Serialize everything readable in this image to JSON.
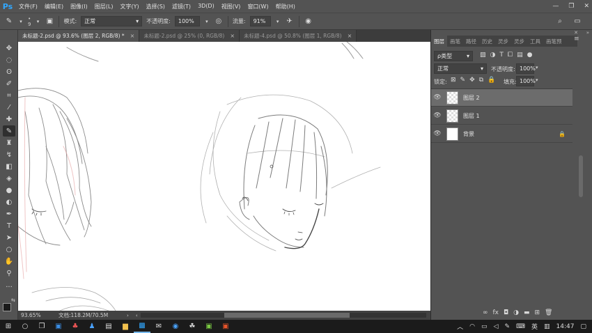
{
  "app": {
    "logo": "Ps"
  },
  "menu": [
    "文件(F)",
    "编辑(E)",
    "图像(I)",
    "图层(L)",
    "文字(Y)",
    "选择(S)",
    "滤镜(T)",
    "3D(D)",
    "视图(V)",
    "窗口(W)",
    "帮助(H)"
  ],
  "options": {
    "brush_size": "9",
    "mode_label": "模式:",
    "mode_value": "正常",
    "opacity_label": "不透明度:",
    "opacity_value": "100%",
    "flow_label": "流量:",
    "flow_value": "91%"
  },
  "tabs": [
    {
      "label": "未标题-2.psd @ 93.6% (图层 2, RGB/8) *",
      "active": true
    },
    {
      "label": "未标题-2.psd @ 25% (0, RGB/8)",
      "active": false
    },
    {
      "label": "未标题-4.psd @ 50.8% (图层 1, RGB/8)",
      "active": false
    }
  ],
  "status": {
    "zoom": "93.65%",
    "doc": "文档:118.2M/70.5M"
  },
  "panel": {
    "tabs": [
      "图层",
      "画笔",
      "路径",
      "历史",
      "灵步",
      "灵步",
      "工具",
      "画笔预"
    ],
    "filter_label": "ρ类型",
    "blend_mode": "正常",
    "opacity_label": "不透明度:",
    "opacity_value": "100%",
    "lock_label": "锁定:",
    "fill_label": "填充:",
    "fill_value": "100%",
    "layers": [
      {
        "name": "图层 2",
        "selected": true,
        "checker": true
      },
      {
        "name": "图层 1",
        "selected": false,
        "checker": true
      },
      {
        "name": "背景",
        "selected": false,
        "checker": false
      }
    ]
  },
  "taskbar": {
    "ime": "英",
    "time": "14:47"
  },
  "colors": {
    "chrome": "#535353",
    "canvas": "#ffffff",
    "accent": "#31a8ff"
  }
}
